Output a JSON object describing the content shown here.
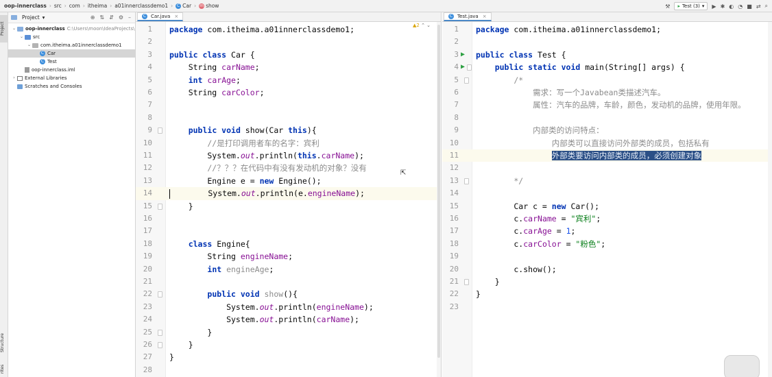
{
  "breadcrumbs": [
    {
      "label": "oop-innerclass"
    },
    {
      "label": "src"
    },
    {
      "label": "com"
    },
    {
      "label": "itheima"
    },
    {
      "label": "a01innerclassdemo1"
    },
    {
      "label": "Car",
      "icon": "class-icon"
    },
    {
      "label": "show",
      "icon": "method-icon"
    }
  ],
  "toolbar": {
    "run_config": "Test (3)"
  },
  "left_strip": {
    "project_tab": "Project",
    "structure_tab": "Structure",
    "other_tab": "rites"
  },
  "project": {
    "header": "Project",
    "tree": [
      {
        "label": "oop-innerclass",
        "path": "C:\\Users\\moon\\IdeaProjects\\",
        "depth": 0,
        "expanded": true,
        "icon": "folder-icon"
      },
      {
        "label": "src",
        "depth": 1,
        "expanded": true,
        "icon": "source-folder-icon"
      },
      {
        "label": "com.itheima.a01innerclassdemo1",
        "depth": 2,
        "expanded": true,
        "icon": "package-icon"
      },
      {
        "label": "Car",
        "depth": 3,
        "icon": "class-icon",
        "selected": true
      },
      {
        "label": "Test",
        "depth": 3,
        "icon": "class-icon"
      },
      {
        "label": "oop-innerclass.iml",
        "depth": 1,
        "icon": "iml-file-icon"
      },
      {
        "label": "External Libraries",
        "depth": 0,
        "expanded": false,
        "icon": "library-icon"
      },
      {
        "label": "Scratches and Consoles",
        "depth": 0,
        "icon": "scratches-icon"
      }
    ]
  },
  "editors": {
    "left": {
      "tab": "Car.java",
      "inspection": "▲2",
      "lines": [
        [
          [
            "kw",
            "package"
          ],
          [
            "t",
            " com.itheima.a01innerclassdemo1;"
          ]
        ],
        [],
        [
          [
            "kw",
            "public class"
          ],
          [
            "t",
            " Car {"
          ]
        ],
        [
          [
            "t",
            "    String "
          ],
          [
            "fld",
            "carName"
          ],
          [
            "t",
            ";"
          ]
        ],
        [
          [
            "t",
            "    "
          ],
          [
            "kw",
            "int"
          ],
          [
            "t",
            " "
          ],
          [
            "fld",
            "carAge"
          ],
          [
            "t",
            ";"
          ]
        ],
        [
          [
            "t",
            "    String "
          ],
          [
            "fld",
            "carColor"
          ],
          [
            "t",
            ";"
          ]
        ],
        [],
        [],
        [
          [
            "t",
            "    "
          ],
          [
            "kw",
            "public void"
          ],
          [
            "t",
            " show(Car "
          ],
          [
            "kw",
            "this"
          ],
          [
            "t",
            "){"
          ]
        ],
        [
          [
            "cm",
            "        //是打印调用者车的名字：宾利"
          ]
        ],
        [
          [
            "t",
            "        System."
          ],
          [
            "it",
            "out"
          ],
          [
            "t",
            ".println("
          ],
          [
            "kw",
            "this"
          ],
          [
            "t",
            "."
          ],
          [
            "fld",
            "carName"
          ],
          [
            "t",
            ");"
          ]
        ],
        [
          [
            "cm",
            "        //？？？在代码中有没有发动机的对象？没有"
          ]
        ],
        [
          [
            "t",
            "        Engine e = "
          ],
          [
            "kw",
            "new"
          ],
          [
            "t",
            " Engine();"
          ]
        ],
        [
          [
            "t",
            "        System."
          ],
          [
            "it",
            "out"
          ],
          [
            "t",
            ".println(e."
          ],
          [
            "fld",
            "engineName"
          ],
          [
            "t",
            ");"
          ]
        ],
        [
          [
            "t",
            "    }"
          ]
        ],
        [],
        [],
        [
          [
            "t",
            "    "
          ],
          [
            "kw",
            "class"
          ],
          [
            "t",
            " Engine{"
          ]
        ],
        [
          [
            "t",
            "        String "
          ],
          [
            "fld",
            "engineName"
          ],
          [
            "t",
            ";"
          ]
        ],
        [
          [
            "t",
            "        "
          ],
          [
            "kw",
            "int"
          ],
          [
            "t",
            " "
          ],
          [
            "cmd",
            "engineAge"
          ],
          [
            "t",
            ";"
          ]
        ],
        [],
        [
          [
            "t",
            "        "
          ],
          [
            "kw",
            "public void"
          ],
          [
            "t",
            " "
          ],
          [
            "cmd",
            "show"
          ],
          [
            "t",
            "(){"
          ]
        ],
        [
          [
            "t",
            "            System."
          ],
          [
            "it",
            "out"
          ],
          [
            "t",
            ".println("
          ],
          [
            "fld",
            "engineName"
          ],
          [
            "t",
            ");"
          ]
        ],
        [
          [
            "t",
            "            System."
          ],
          [
            "it",
            "out"
          ],
          [
            "t",
            ".println("
          ],
          [
            "fld",
            "carName"
          ],
          [
            "t",
            ");"
          ]
        ],
        [
          [
            "t",
            "        }"
          ]
        ],
        [
          [
            "t",
            "    }"
          ]
        ],
        [
          [
            "t",
            "}"
          ]
        ],
        []
      ]
    },
    "right": {
      "tab": "Test.java",
      "lines": [
        [
          [
            "kw",
            "package"
          ],
          [
            "t",
            " com.itheima.a01innerclassdemo1;"
          ]
        ],
        [],
        [
          [
            "kw",
            "public class"
          ],
          [
            "t",
            " Test {"
          ]
        ],
        [
          [
            "t",
            "    "
          ],
          [
            "kw",
            "public static void"
          ],
          [
            "t",
            " main(String[] args) {"
          ]
        ],
        [
          [
            "cm",
            "        /*"
          ]
        ],
        [
          [
            "cm",
            "            需求：写一个Javabean类描述汽车。"
          ]
        ],
        [
          [
            "cm",
            "            属性：汽车的品牌，车龄，颜色，发动机的品牌，使用年限。"
          ]
        ],
        [],
        [
          [
            "cm",
            "            内部类的访问特点："
          ]
        ],
        [
          [
            "cm",
            "                内部类可以直接访问外部类的成员，包括私有"
          ]
        ],
        [
          [
            "cm",
            "                "
          ],
          [
            "hl",
            "外部类要访问内部类的成员，必须创建对象"
          ]
        ],
        [],
        [
          [
            "cm",
            "        */"
          ]
        ],
        [],
        [
          [
            "t",
            "        Car c = "
          ],
          [
            "kw",
            "new"
          ],
          [
            "t",
            " Car();"
          ]
        ],
        [
          [
            "t",
            "        c."
          ],
          [
            "fld",
            "carName"
          ],
          [
            "t",
            " = "
          ],
          [
            "str",
            "\"宾利\""
          ],
          [
            "t",
            ";"
          ]
        ],
        [
          [
            "t",
            "        c."
          ],
          [
            "fld",
            "carAge"
          ],
          [
            "t",
            " = "
          ],
          [
            "kwn",
            "1"
          ],
          [
            "t",
            ";"
          ]
        ],
        [
          [
            "t",
            "        c."
          ],
          [
            "fld",
            "carColor"
          ],
          [
            "t",
            " = "
          ],
          [
            "str",
            "\"粉色\""
          ],
          [
            "t",
            ";"
          ]
        ],
        [],
        [
          [
            "t",
            "        c.show();"
          ]
        ],
        [
          [
            "t",
            "    }"
          ]
        ],
        [
          [
            "t",
            "}"
          ]
        ],
        []
      ]
    }
  },
  "colors": {
    "keyword": "#0033b3",
    "field": "#871094",
    "string": "#067d17",
    "comment": "#8c8c8c",
    "selection": "#2b4f86",
    "run_gutter": "#2ea043"
  }
}
